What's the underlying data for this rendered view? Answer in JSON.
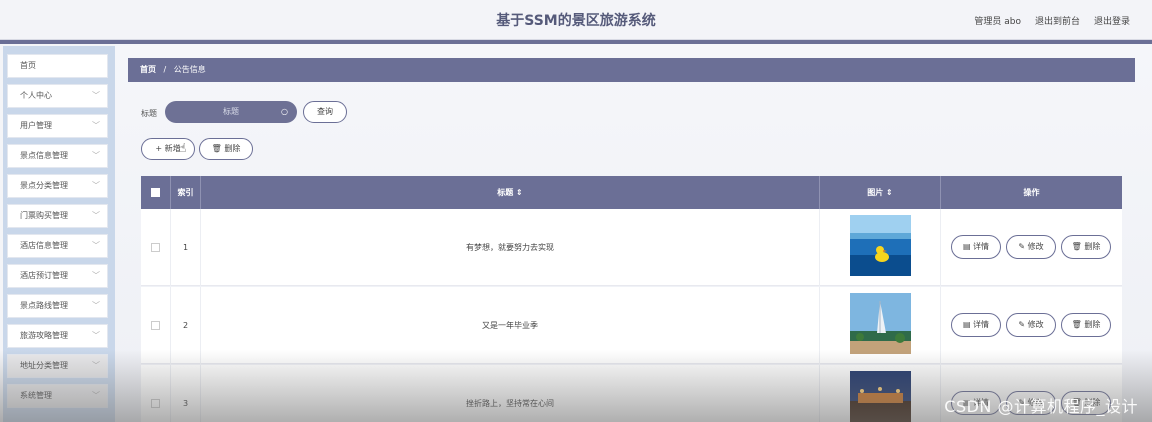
{
  "header": {
    "title": "基于SSM的景区旅游系统",
    "admin": "管理员 abo",
    "back_front": "退出到前台",
    "logout": "退出登录"
  },
  "sidebar": {
    "items": [
      {
        "label": "首页",
        "chevron": false
      },
      {
        "label": "个人中心",
        "chevron": true
      },
      {
        "label": "用户管理",
        "chevron": true
      },
      {
        "label": "景点信息管理",
        "chevron": true
      },
      {
        "label": "景点分类管理",
        "chevron": true
      },
      {
        "label": "门票购买管理",
        "chevron": true
      },
      {
        "label": "酒店信息管理",
        "chevron": true
      },
      {
        "label": "酒店预订管理",
        "chevron": true
      },
      {
        "label": "景点路线管理",
        "chevron": true
      },
      {
        "label": "旅游攻略管理",
        "chevron": true
      },
      {
        "label": "地址分类管理",
        "chevron": true
      },
      {
        "label": "系统管理",
        "chevron": true
      }
    ],
    "chevron_glyph": "﹀"
  },
  "breadcrumb": {
    "home": "首页",
    "sep": "/",
    "current": "公告信息"
  },
  "search": {
    "label": "标题",
    "placeholder": "标题",
    "query_button": "查询"
  },
  "actions": {
    "add": "+ 新增",
    "delete": "删除"
  },
  "table": {
    "headers": {
      "index": "索引",
      "title": "标题 ⇕",
      "image": "图片 ⇕",
      "ops": "操作"
    },
    "rows": [
      {
        "index": "1",
        "title": "有梦想，就要努力去实现",
        "image_subject": "yellow-duck-pool"
      },
      {
        "index": "2",
        "title": "又是一年毕业季",
        "image_subject": "burj-al-arab"
      },
      {
        "index": "3",
        "title": "挫折路上，坚持常在心间",
        "image_subject": "night-boats"
      }
    ],
    "op_labels": {
      "detail": "详情",
      "edit": "修改",
      "delete": "删除"
    }
  },
  "watermark": "CSDN @计算机程序_设计",
  "colors": {
    "accent": "#6b6f96",
    "sidebar_bg": "#c9d7ea",
    "header_bg": "#f3f4f8"
  }
}
